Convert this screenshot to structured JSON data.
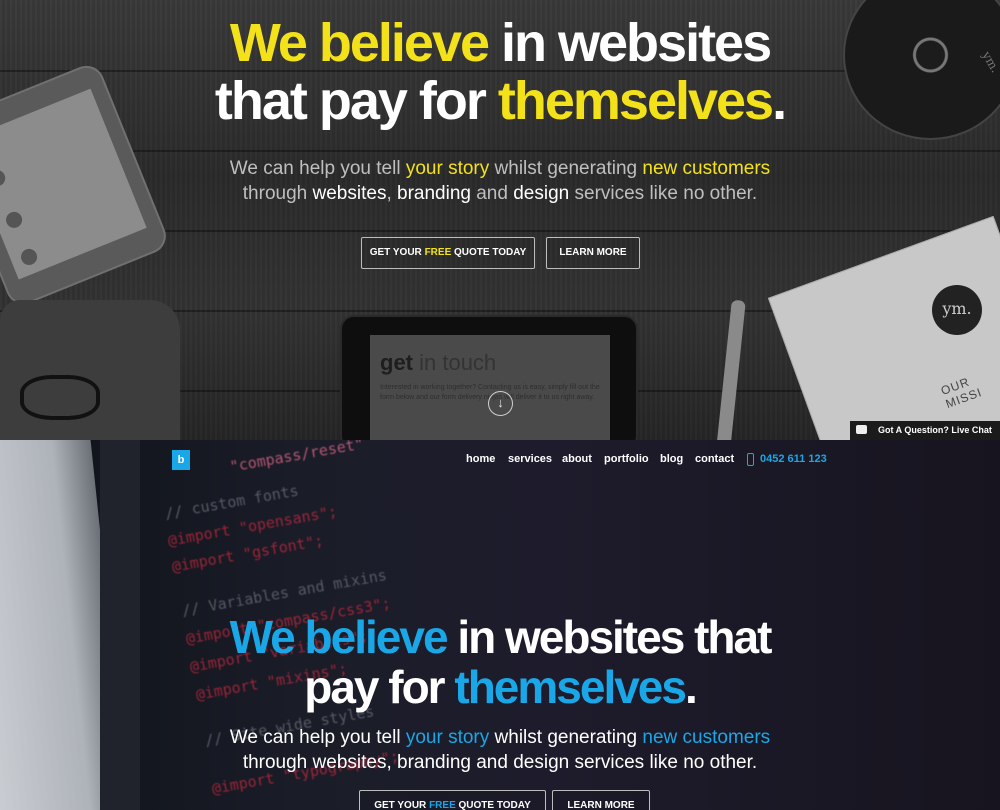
{
  "top_hero": {
    "headline": {
      "part1": "We believe",
      "part2": " in websites",
      "part3": "that pay for ",
      "part4": "themselves",
      "part5": "."
    },
    "subline": {
      "s1": "We can help you tell ",
      "s2": "your story",
      "s3": " whilst generating ",
      "s4": "new customers",
      "s5": "through ",
      "s6": "websites",
      "s7": ", ",
      "s8": "branding",
      "s9": " and ",
      "s10": "design",
      "s11": " services like no other."
    },
    "quote_button": {
      "before": "GET YOUR ",
      "highlight": "FREE",
      "after": " QUOTE TODAY"
    },
    "learn_more_button": "LEARN MORE",
    "tablet": {
      "title_bold": "get",
      "title_rest": " in touch",
      "body": "Interested in working together? Contacting us is easy, simply fill out the form below and our form delivery ninjas will deliver it to us right away."
    },
    "cd_logo": "ym.",
    "book_logo": "ym.",
    "book_text": "OUR MISSI",
    "live_chat": "Got A Question? Live Chat",
    "accent_color": "#f3e21a"
  },
  "bottom_hero": {
    "nav_logo": "b",
    "nav": {
      "home": "home",
      "services": "services",
      "about": "about",
      "portfolio": "portfolio",
      "blog": "blog",
      "contact": "contact",
      "phone": "0452 611 123"
    },
    "headline": {
      "part1": "We believe",
      "part2": " in websites that",
      "part3": "pay for ",
      "part4": "themselves",
      "part5": "."
    },
    "subline": {
      "s1": "We can help you tell ",
      "s2": "your story",
      "s3": " whilst generating ",
      "s4": "new customers",
      "s5": "through websites, branding and design services like no other."
    },
    "quote_button": {
      "before": "GET YOUR ",
      "highlight": "FREE",
      "after": " QUOTE TODAY"
    },
    "learn_more_button": "LEARN MORE",
    "code": {
      "l1": "\"compass/reset\"",
      "l2": "// custom fonts",
      "l3": "@import \"opensans\";",
      "l4": "@import \"gsfont\";",
      "l5": "// Variables and mixins",
      "l6": "@import \"compass/css3\";",
      "l7": "@import \"variables\";",
      "l8": "@import \"mixins\";",
      "l9": "// Site wide styles",
      "l10": "@import \"typography\";"
    },
    "accent_color": "#1aa7e8"
  }
}
